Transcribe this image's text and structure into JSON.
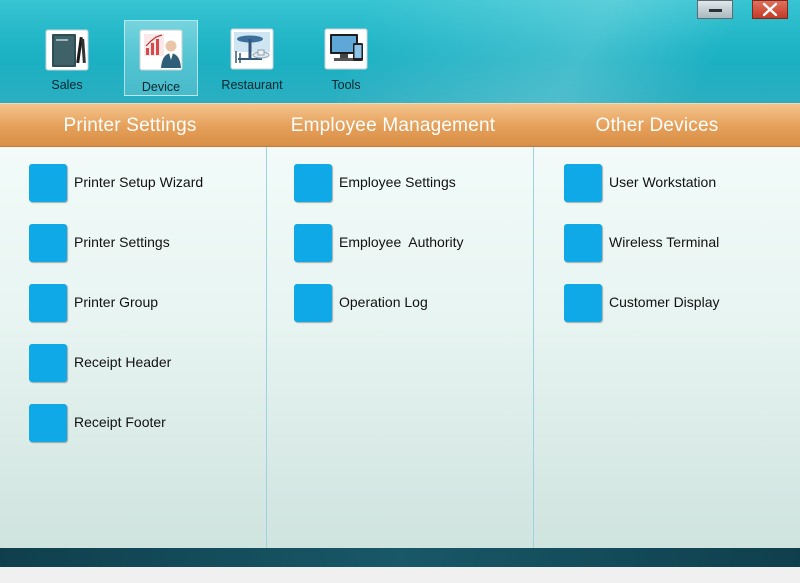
{
  "nav": {
    "items": [
      {
        "label": "Sales",
        "icon": "sales-book-icon",
        "active": false
      },
      {
        "label": "Device",
        "icon": "device-chart-icon",
        "active": true
      },
      {
        "label": "Restaurant",
        "icon": "restaurant-table-icon",
        "active": false
      },
      {
        "label": "Tools",
        "icon": "tools-devices-icon",
        "active": false
      }
    ]
  },
  "window": {
    "minimize_icon": "minimize-icon",
    "close_icon": "close-icon"
  },
  "sections": [
    {
      "title": "Printer Settings",
      "items": [
        {
          "label": "Printer Setup Wizard"
        },
        {
          "label": "Printer Settings"
        },
        {
          "label": "Printer Group"
        },
        {
          "label": "Receipt Header"
        },
        {
          "label": "Receipt Footer"
        }
      ]
    },
    {
      "title": "Employee Management",
      "items": [
        {
          "label": "Employee Settings"
        },
        {
          "label": "Employee  Authority"
        },
        {
          "label": "Operation Log"
        }
      ]
    },
    {
      "title": "Other Devices",
      "items": [
        {
          "label": "User Workstation"
        },
        {
          "label": "Wireless Terminal"
        },
        {
          "label": "Customer Display"
        }
      ]
    }
  ],
  "colors": {
    "toolbar": "#1eb4c6",
    "header": "#e59f59",
    "tile": "#0ea9e6",
    "bottom_bar": "#185867"
  }
}
